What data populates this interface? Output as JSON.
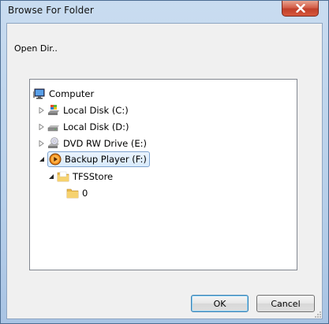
{
  "window": {
    "title": "Browse For Folder",
    "instructions": "Open Dir..",
    "close_label": "Close"
  },
  "tree": {
    "items": [
      {
        "label": "Computer",
        "icon": "computer-icon",
        "expander": "none"
      },
      {
        "label": "Local Disk (C:)",
        "icon": "local-disk-windows-icon",
        "expander": "collapsed"
      },
      {
        "label": "Local Disk (D:)",
        "icon": "hard-drive-icon",
        "expander": "collapsed"
      },
      {
        "label": "DVD RW Drive (E:)",
        "icon": "dvd-drive-icon",
        "expander": "collapsed"
      },
      {
        "label": "Backup Player (F:)",
        "icon": "media-player-drive-icon",
        "expander": "expanded",
        "selected": true
      },
      {
        "label": "TFSStore",
        "icon": "folder-icon",
        "expander": "expanded"
      },
      {
        "label": "0",
        "icon": "folder-icon",
        "expander": "none"
      }
    ]
  },
  "buttons": {
    "ok_label": "OK",
    "cancel_label": "Cancel"
  },
  "colors": {
    "frame": "#b8d0ea",
    "client": "#f0f0f0",
    "selection_border": "#7da2ce",
    "close_red": "#c0402a"
  }
}
